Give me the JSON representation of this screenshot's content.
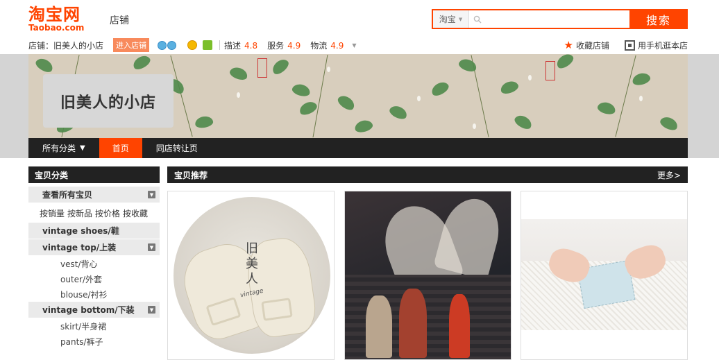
{
  "header": {
    "logo_cn": "淘宝网",
    "logo_en": "Taobao.com",
    "tab_label": "店铺",
    "search": {
      "scope": "淘宝",
      "placeholder": "",
      "button": "搜索"
    }
  },
  "shopbar": {
    "shop_label": "店铺：",
    "shop_name": "旧美人的小店",
    "enter_button": "进入店铺",
    "ratings": [
      {
        "label": "描述",
        "value": "4.8"
      },
      {
        "label": "服务",
        "value": "4.9"
      },
      {
        "label": "物流",
        "value": "4.9"
      }
    ],
    "favorite": "收藏店铺",
    "mobile": "用手机逛本店"
  },
  "banner": {
    "shop_title": "旧美人的小店"
  },
  "nav": {
    "items": [
      {
        "label": "所有分类",
        "arrow": "▼"
      },
      {
        "label": "首页"
      },
      {
        "label": "同店转让页"
      }
    ]
  },
  "sidebar": {
    "title": "宝贝分类",
    "view_all": "查看所有宝贝",
    "sort_links": [
      "按销量",
      "按新品",
      "按价格",
      "按收藏"
    ],
    "categories": [
      {
        "label": "vintage shoes/鞋",
        "subs": []
      },
      {
        "label": "vintage top/上装",
        "subs": [
          "vest/背心",
          "outer/外套",
          "blouse/衬衫"
        ]
      },
      {
        "label": "vintage bottom/下装",
        "subs": [
          "skirt/半身裙",
          "pants/裤子"
        ]
      }
    ]
  },
  "main": {
    "title": "宝贝推荐",
    "more": "更多>"
  },
  "product1": {
    "vertical_text": "旧美人",
    "caption": "vintage"
  },
  "colors": {
    "accent": "#ff4400",
    "nav_bg": "#222222",
    "banner_bg": "#d8cebd"
  },
  "icons": [
    "search-icon",
    "crown-icon",
    "medal-icon",
    "star-icon",
    "qrcode-icon",
    "toggle-icon"
  ]
}
